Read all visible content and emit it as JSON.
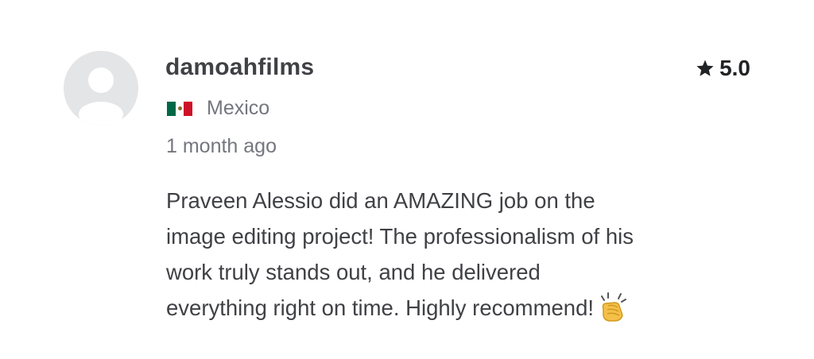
{
  "review": {
    "username": "damoahfilms",
    "rating": "5.0",
    "country": "Mexico",
    "time_ago": "1 month ago",
    "body_lines": [
      "Praveen Alessio did an AMAZING job on the",
      "image editing project! The professionalism of his",
      "work truly stands out, and he delivered",
      "everything right on time. Highly recommend!"
    ],
    "emoji": "clapping-hands-icon"
  },
  "colors": {
    "avatar_bg": "#e4e5e7",
    "avatar_silhouette": "#ffffff",
    "username": "#404145",
    "muted_text": "#74767e",
    "star": "#222325",
    "flag_green": "#006847",
    "flag_white": "#ffffff",
    "flag_red": "#ce1126",
    "emoji_yellow": "#f4c04a"
  }
}
